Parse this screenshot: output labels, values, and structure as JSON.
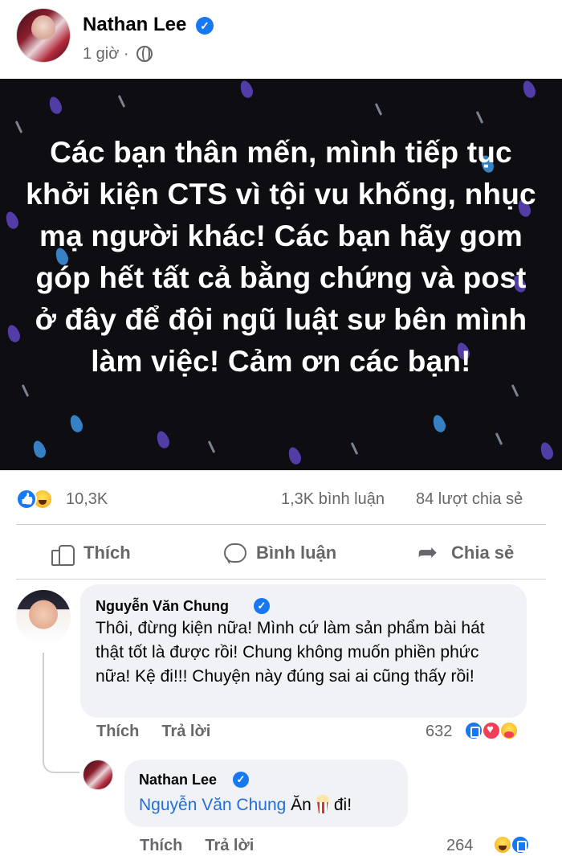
{
  "post": {
    "author": "Nathan Lee",
    "time": "1 giờ ·",
    "image_text": "Các bạn thân mến, mình tiếp tục khởi kiện CTS vì tội vu khống, nhục mạ người khác! Các bạn hãy gom góp hết tất cả bằng chứng và post ở đây để đội ngũ luật sư bên mình làm việc! Cảm ơn các bạn!",
    "reaction_count": "10,3K",
    "comment_count": "1,3K bình luận",
    "share_count": "84 lượt chia sẻ",
    "reaction_icons": [
      "like-icon",
      "haha-icon"
    ]
  },
  "actions": {
    "like": "Thích",
    "comment": "Bình luận",
    "share": "Chia sẻ"
  },
  "comments": [
    {
      "author": "Nguyễn Văn Chung",
      "verified": true,
      "text": "Thôi, đừng kiện nữa! Mình cứ làm sản phẩm bài hát thật tốt là được rồi! Chung không muốn phiền phức nữa! Kệ đi!!! Chuyện này đúng sai ai cũng thấy rồi!",
      "like_label": "Thích",
      "reply_label": "Trả lời",
      "reaction_count": "632",
      "reaction_icons": [
        "like-icon",
        "love-icon",
        "care-icon"
      ]
    },
    {
      "author": "Nathan Lee",
      "verified": true,
      "mention": "Nguyễn Văn Chung",
      "text_before_emoji": "Ăn",
      "emoji": "popcorn-icon",
      "text_after_emoji": "đi!",
      "like_label": "Thích",
      "reply_label": "Trả lời",
      "reaction_count": "264",
      "reaction_icons": [
        "haha-icon",
        "like-icon"
      ]
    }
  ],
  "colors": {
    "facebook_blue": "#1877f2",
    "mention_blue": "#216fdb",
    "secondary_text": "#65676b",
    "bubble_bg": "#f0f2f5",
    "image_bg": "#0d0d12",
    "drop_purple": "#5a43b8"
  }
}
